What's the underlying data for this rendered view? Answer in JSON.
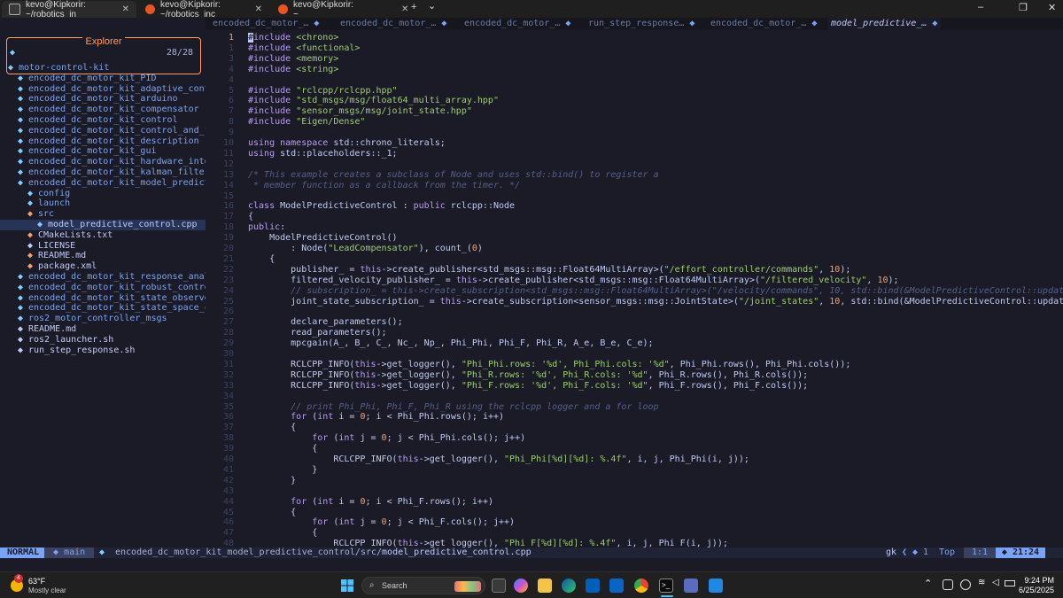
{
  "terminal": {
    "tabs": [
      {
        "title": "kevo@Kipkorir: ~/robotics_in",
        "active": true
      },
      {
        "title": "kevo@Kipkorir: ~/robotics_inc",
        "active": false
      },
      {
        "title": "kevo@Kipkorir: ~",
        "active": false
      }
    ],
    "new_tab": "+",
    "dropdown": "⌄",
    "minimize": "–",
    "maximize": "❐",
    "close": "✕"
  },
  "explorer": {
    "title": "Explorer",
    "input_prompt": "◆",
    "count": "28/28",
    "items": [
      {
        "name": "motor-control-kit",
        "depth": 0,
        "kind": "dir"
      },
      {
        "name": "encoded_dc_motor_kit_PID",
        "depth": 1,
        "kind": "dir"
      },
      {
        "name": "encoded_dc_motor_kit_adaptive_contr",
        "depth": 1,
        "kind": "dir"
      },
      {
        "name": "encoded_dc_motor_kit_arduino",
        "depth": 1,
        "kind": "dir"
      },
      {
        "name": "encoded_dc_motor_kit_compensator",
        "depth": 1,
        "kind": "dir"
      },
      {
        "name": "encoded_dc_motor_kit_control",
        "depth": 1,
        "kind": "dir"
      },
      {
        "name": "encoded_dc_motor_kit_control_and_fe",
        "depth": 1,
        "kind": "dir"
      },
      {
        "name": "encoded_dc_motor_kit_description",
        "depth": 1,
        "kind": "dir"
      },
      {
        "name": "encoded_dc_motor_kit_gui",
        "depth": 1,
        "kind": "dir"
      },
      {
        "name": "encoded_dc_motor_kit_hardware_inter",
        "depth": 1,
        "kind": "dir"
      },
      {
        "name": "encoded_dc_motor_kit_kalman_filters",
        "depth": 1,
        "kind": "dir"
      },
      {
        "name": "encoded_dc_motor_kit_model_predicti",
        "depth": 1,
        "kind": "dir"
      },
      {
        "name": "config",
        "depth": 2,
        "kind": "dir"
      },
      {
        "name": "launch",
        "depth": 2,
        "kind": "dir"
      },
      {
        "name": "src",
        "depth": 2,
        "kind": "src"
      },
      {
        "name": "model_predictive_control.cpp",
        "depth": 3,
        "kind": "cpp",
        "selected": true
      },
      {
        "name": "CMakeLists.txt",
        "depth": 2,
        "kind": "orange"
      },
      {
        "name": "LICENSE",
        "depth": 2,
        "kind": "file"
      },
      {
        "name": "README.md",
        "depth": 2,
        "kind": "orange"
      },
      {
        "name": "package.xml",
        "depth": 2,
        "kind": "orange"
      },
      {
        "name": "encoded_dc_motor_kit_response_analy",
        "depth": 1,
        "kind": "dir"
      },
      {
        "name": "encoded_dc_motor_kit_robust_control",
        "depth": 1,
        "kind": "dir"
      },
      {
        "name": "encoded_dc_motor_kit_state_observer",
        "depth": 1,
        "kind": "dir"
      },
      {
        "name": "encoded_dc_motor_kit_state_space_co",
        "depth": 1,
        "kind": "dir"
      },
      {
        "name": "ros2_motor_controller_msgs",
        "depth": 1,
        "kind": "dir"
      },
      {
        "name": "README.md",
        "depth": 1,
        "kind": "file"
      },
      {
        "name": "ros2_launcher.sh",
        "depth": 1,
        "kind": "file"
      },
      {
        "name": "run_step_response.sh",
        "depth": 1,
        "kind": "file"
      }
    ]
  },
  "buffers": [
    {
      "label": "encoded_dc_motor_…",
      "active": false
    },
    {
      "label": "encoded_dc_motor_…",
      "active": false
    },
    {
      "label": "encoded_dc_motor_…",
      "active": false
    },
    {
      "label": "run_step_response…",
      "active": false
    },
    {
      "label": "encoded_dc_motor_…",
      "active": false
    },
    {
      "label": "model_predictive_…",
      "active": true
    }
  ],
  "code": [
    {
      "n": "1",
      "cur": true,
      "indent": 0,
      "t": [
        [
          "cursor",
          "#"
        ],
        [
          "k",
          "include "
        ],
        [
          "s",
          "<chrono>"
        ]
      ]
    },
    {
      "n": "1",
      "indent": 0,
      "t": [
        [
          "k",
          "#include "
        ],
        [
          "s",
          "<functional>"
        ]
      ]
    },
    {
      "n": "3",
      "indent": 0,
      "t": [
        [
          "k",
          "#include "
        ],
        [
          "s",
          "<memory>"
        ]
      ]
    },
    {
      "n": "4",
      "indent": 0,
      "t": [
        [
          "k",
          "#include "
        ],
        [
          "s",
          "<string>"
        ]
      ]
    },
    {
      "n": "4",
      "indent": 0,
      "t": []
    },
    {
      "n": "5",
      "indent": 0,
      "t": [
        [
          "k",
          "#include "
        ],
        [
          "s",
          "\"rclcpp/rclcpp.hpp\""
        ]
      ]
    },
    {
      "n": "6",
      "indent": 0,
      "t": [
        [
          "k",
          "#include "
        ],
        [
          "s",
          "\"std_msgs/msg/float64_multi_array.hpp\""
        ]
      ]
    },
    {
      "n": "7",
      "indent": 0,
      "t": [
        [
          "k",
          "#include "
        ],
        [
          "s",
          "\"sensor_msgs/msg/joint_state.hpp\""
        ]
      ]
    },
    {
      "n": "8",
      "indent": 0,
      "t": [
        [
          "k",
          "#include "
        ],
        [
          "s",
          "\"Eigen/Dense\""
        ]
      ]
    },
    {
      "n": "9",
      "indent": 0,
      "t": []
    },
    {
      "n": "10",
      "indent": 0,
      "t": [
        [
          "k",
          "using namespace "
        ],
        [
          "",
          "std::chrono_literals;"
        ]
      ]
    },
    {
      "n": "11",
      "indent": 0,
      "t": [
        [
          "k",
          "using "
        ],
        [
          "",
          "std::placeholders::_1;"
        ]
      ]
    },
    {
      "n": "12",
      "indent": 0,
      "t": []
    },
    {
      "n": "13",
      "indent": 0,
      "t": [
        [
          "c",
          "/* This example creates a subclass of Node and uses std::bind() to register a"
        ]
      ]
    },
    {
      "n": "14",
      "indent": 0,
      "t": [
        [
          "c",
          " * member function as a callback from the timer. */"
        ]
      ]
    },
    {
      "n": "15",
      "indent": 0,
      "t": []
    },
    {
      "n": "16",
      "indent": 0,
      "t": [
        [
          "k",
          "class "
        ],
        [
          "",
          "ModelPredictiveControl : "
        ],
        [
          "k",
          "public "
        ],
        [
          "",
          "rclcpp::Node"
        ]
      ]
    },
    {
      "n": "17",
      "indent": 0,
      "t": [
        [
          "",
          "{"
        ]
      ]
    },
    {
      "n": "18",
      "indent": 0,
      "t": [
        [
          "k",
          "public"
        ],
        [
          "",
          ":"
        ]
      ]
    },
    {
      "n": "19",
      "indent": 0,
      "t": [
        [
          "",
          "    ModelPredictiveControl()"
        ]
      ]
    },
    {
      "n": "20",
      "indent": 0,
      "t": [
        [
          "",
          "        : Node("
        ],
        [
          "s",
          "\"LeadCompensator\""
        ],
        [
          "",
          "), count_("
        ],
        [
          "n",
          "0"
        ],
        [
          "",
          ")"
        ]
      ]
    },
    {
      "n": "21",
      "indent": 0,
      "t": [
        [
          "",
          "    {"
        ]
      ]
    },
    {
      "n": "22",
      "indent": 0,
      "t": [
        [
          "",
          "        publisher_ = "
        ],
        [
          "k",
          "this"
        ],
        [
          "",
          "->create_publisher<std_msgs::msg::Float64MultiArray>("
        ],
        [
          "s",
          "\"/effort_controller/commands\""
        ],
        [
          "",
          ", "
        ],
        [
          "n",
          "10"
        ],
        [
          "",
          ");"
        ]
      ]
    },
    {
      "n": "23",
      "indent": 0,
      "t": [
        [
          "",
          "        filtered_velocity_publisher_ = "
        ],
        [
          "k",
          "this"
        ],
        [
          "",
          "->create_publisher<std_msgs::msg::Float64MultiArray>("
        ],
        [
          "s",
          "\"/filtered_velocity\""
        ],
        [
          "",
          ", "
        ],
        [
          "n",
          "10"
        ],
        [
          "",
          ");"
        ]
      ]
    },
    {
      "n": "24",
      "indent": 0,
      "t": [
        [
          "c",
          "        // subscription_ = this->create_subscription<std_msgs::msg::Float64MultiArray>(\"/velocity/commands\", 10, std::bind(&ModelPredictiveControl::update_refer"
        ]
      ]
    },
    {
      "n": "25",
      "indent": 0,
      "t": [
        [
          "",
          "        joint_state_subscription_ = "
        ],
        [
          "k",
          "this"
        ],
        [
          "",
          "->create_subscription<sensor_msgs::msg::JointState>("
        ],
        [
          "s",
          "\"/joint_states\""
        ],
        [
          "",
          ", "
        ],
        [
          "n",
          "10"
        ],
        [
          "",
          ", std::bind(&ModelPredictiveControl::update_shaft"
        ]
      ]
    },
    {
      "n": "26",
      "indent": 0,
      "t": []
    },
    {
      "n": "27",
      "indent": 0,
      "t": [
        [
          "",
          "        declare_parameters();"
        ]
      ]
    },
    {
      "n": "28",
      "indent": 0,
      "t": [
        [
          "",
          "        read_parameters();"
        ]
      ]
    },
    {
      "n": "29",
      "indent": 0,
      "t": [
        [
          "",
          "        mpcgain(A_, B_, C_, Nc_, Np_, Phi_Phi, Phi_F, Phi_R, A_e, B_e, C_e);"
        ]
      ]
    },
    {
      "n": "30",
      "indent": 0,
      "t": []
    },
    {
      "n": "31",
      "indent": 0,
      "t": [
        [
          "",
          "        RCLCPP_INFO("
        ],
        [
          "k",
          "this"
        ],
        [
          "",
          "->get_logger(), "
        ],
        [
          "s",
          "\"Phi_Phi.rows: '%d', Phi_Phi.cols: '%d\""
        ],
        [
          "",
          ", Phi_Phi.rows(), Phi_Phi.cols());"
        ]
      ]
    },
    {
      "n": "32",
      "indent": 0,
      "t": [
        [
          "",
          "        RCLCPP_INFO("
        ],
        [
          "k",
          "this"
        ],
        [
          "",
          "->get_logger(), "
        ],
        [
          "s",
          "\"Phi_R.rows: '%d', Phi_R.cols: '%d\""
        ],
        [
          "",
          ", Phi_R.rows(), Phi_R.cols());"
        ]
      ]
    },
    {
      "n": "33",
      "indent": 0,
      "t": [
        [
          "",
          "        RCLCPP_INFO("
        ],
        [
          "k",
          "this"
        ],
        [
          "",
          "->get_logger(), "
        ],
        [
          "s",
          "\"Phi_F.rows: '%d', Phi_F.cols: '%d\""
        ],
        [
          "",
          ", Phi_F.rows(), Phi_F.cols());"
        ]
      ]
    },
    {
      "n": "34",
      "indent": 0,
      "t": []
    },
    {
      "n": "35",
      "indent": 0,
      "t": [
        [
          "c",
          "        // print Phi_Phi, Phi_F, Phi_R using the rclcpp logger and a for loop"
        ]
      ]
    },
    {
      "n": "36",
      "indent": 0,
      "t": [
        [
          "k",
          "        for "
        ],
        [
          "",
          "("
        ],
        [
          "k",
          "int "
        ],
        [
          "",
          "i = "
        ],
        [
          "n",
          "0"
        ],
        [
          "",
          "; i < Phi_Phi.rows(); i++)"
        ]
      ]
    },
    {
      "n": "37",
      "indent": 0,
      "t": [
        [
          "",
          "        {"
        ]
      ]
    },
    {
      "n": "38",
      "indent": 0,
      "t": [
        [
          "k",
          "            for "
        ],
        [
          "",
          "("
        ],
        [
          "k",
          "int "
        ],
        [
          "",
          "j = "
        ],
        [
          "n",
          "0"
        ],
        [
          "",
          "; j < Phi_Phi.cols(); j++)"
        ]
      ]
    },
    {
      "n": "39",
      "indent": 0,
      "t": [
        [
          "",
          "            {"
        ]
      ]
    },
    {
      "n": "40",
      "indent": 0,
      "t": [
        [
          "",
          "                RCLCPP_INFO("
        ],
        [
          "k",
          "this"
        ],
        [
          "",
          "->get_logger(), "
        ],
        [
          "s",
          "\"Phi_Phi[%d][%d]: %.4f\""
        ],
        [
          "",
          ", i, j, Phi_Phi(i, j));"
        ]
      ]
    },
    {
      "n": "41",
      "indent": 0,
      "t": [
        [
          "",
          "            }"
        ]
      ]
    },
    {
      "n": "42",
      "indent": 0,
      "t": [
        [
          "",
          "        }"
        ]
      ]
    },
    {
      "n": "43",
      "indent": 0,
      "t": []
    },
    {
      "n": "44",
      "indent": 0,
      "t": [
        [
          "k",
          "        for "
        ],
        [
          "",
          "("
        ],
        [
          "k",
          "int "
        ],
        [
          "",
          "i = "
        ],
        [
          "n",
          "0"
        ],
        [
          "",
          "; i < Phi_F.rows(); i++)"
        ]
      ]
    },
    {
      "n": "45",
      "indent": 0,
      "t": [
        [
          "",
          "        {"
        ]
      ]
    },
    {
      "n": "46",
      "indent": 0,
      "t": [
        [
          "k",
          "            for "
        ],
        [
          "",
          "("
        ],
        [
          "k",
          "int "
        ],
        [
          "",
          "j = "
        ],
        [
          "n",
          "0"
        ],
        [
          "",
          "; j < Phi_F.cols(); j++)"
        ]
      ]
    },
    {
      "n": "47",
      "indent": 0,
      "t": [
        [
          "",
          "            {"
        ]
      ]
    },
    {
      "n": "48",
      "indent": 0,
      "t": [
        [
          "",
          "                RCLCPP_INFO("
        ],
        [
          "k",
          "this"
        ],
        [
          "",
          "->get_logger(), "
        ],
        [
          "s",
          "\"Phi_F[%d][%d]: %.4f\""
        ],
        [
          "",
          ", i, j, Phi_F(i, j));"
        ]
      ]
    }
  ],
  "status": {
    "mode": "NORMAL",
    "branch_icon": "◆",
    "branch": "main",
    "file_icon": "◆",
    "path_dir": "encoded_dc_motor_kit_model_predictive_control/src/",
    "path_file": "model_predictive_control.cpp",
    "keys": "gk",
    "lsp": "◆ 1",
    "position": "Top",
    "linecol": "1:1",
    "clock": "◆ 21:24"
  },
  "taskbar": {
    "weather_temp": "63°F",
    "weather_desc": "Mostly clear",
    "weather_badge": "4",
    "search_placeholder": "Search",
    "time": "9:24 PM",
    "date": "6/25/2025",
    "tray_chevron": "⌃"
  },
  "colors": {
    "editor_bg": "#1a1b26",
    "accent_orange": "#ff9e64",
    "dir_blue": "#7aa2f7",
    "keyword": "#bb9af7",
    "string": "#9ece6a",
    "comment": "#565f89"
  }
}
